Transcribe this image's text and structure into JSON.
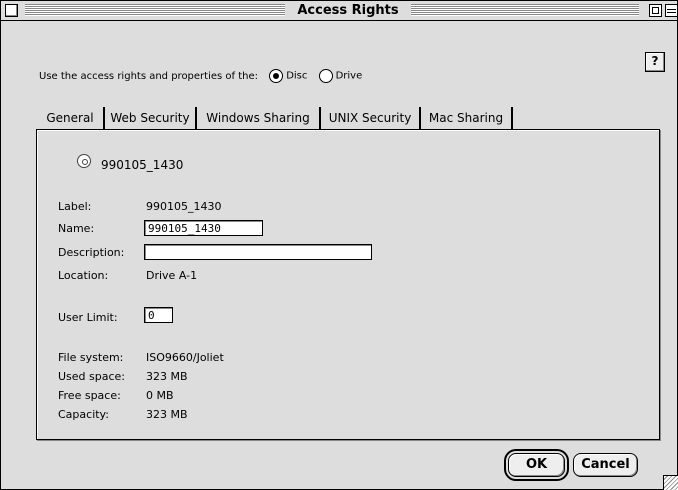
{
  "window": {
    "title": "Access Rights"
  },
  "help": {
    "label": "?"
  },
  "source": {
    "prompt": "Use the access rights and properties of the:",
    "options": [
      {
        "label": "Disc",
        "selected": true
      },
      {
        "label": "Drive",
        "selected": false
      }
    ]
  },
  "tabs": [
    {
      "label": "General",
      "active": true
    },
    {
      "label": "Web Security",
      "active": false
    },
    {
      "label": "Windows Sharing",
      "active": false
    },
    {
      "label": "UNIX Security",
      "active": false
    },
    {
      "label": "Mac Sharing",
      "active": false
    }
  ],
  "general": {
    "disc_name": "990105_1430",
    "label": {
      "caption": "Label:",
      "value": "990105_1430"
    },
    "name": {
      "caption": "Name:",
      "value": "990105_1430"
    },
    "description": {
      "caption": "Description:",
      "value": ""
    },
    "location": {
      "caption": "Location:",
      "value": "Drive A-1"
    },
    "user_limit": {
      "caption": "User Limit:",
      "value": "0"
    },
    "file_system": {
      "caption": "File system:",
      "value": "ISO9660/Joliet"
    },
    "used_space": {
      "caption": "Used space:",
      "value": "323 MB"
    },
    "free_space": {
      "caption": "Free space:",
      "value": "0 MB"
    },
    "capacity": {
      "caption": "Capacity:",
      "value": "323 MB"
    }
  },
  "buttons": {
    "ok": "OK",
    "cancel": "Cancel"
  },
  "icons": {
    "close": "close-box-icon",
    "zoom": "zoom-box-icon",
    "collapse": "collapse-box-icon",
    "disc": "disc-icon",
    "grow": "resize-grip-icon"
  }
}
